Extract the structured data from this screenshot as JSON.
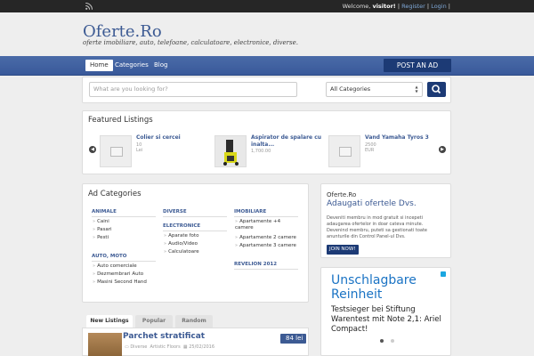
{
  "header": {
    "welcome_prefix": "Welcome,",
    "username": "visitor!",
    "register": "Register",
    "login": "Login",
    "title": "Oferte.Ro",
    "tagline": "oferte imobiliare, auto, telefoane, calculatoare, electronice, diverse."
  },
  "nav": {
    "items": [
      "Home",
      "Categories",
      "Blog"
    ],
    "active": "Home",
    "post_ad": "POST AN AD"
  },
  "search": {
    "placeholder": "What are you looking for?",
    "category": "All Categories"
  },
  "featured": {
    "title": "Featured Listings",
    "items": [
      {
        "name": "Colier si cercei",
        "price": "10 Lei"
      },
      {
        "name": "Aspirator de spalare cu inalta...",
        "price": "1,700.00"
      },
      {
        "name": "Vand Yamaha Tyros 3",
        "price": "2500 EUR"
      }
    ]
  },
  "categories": {
    "title": "Ad Categories",
    "groups": {
      "animale": {
        "name": "ANIMALE",
        "subs": [
          "Caini",
          "Pasari",
          "Pesti"
        ]
      },
      "auto_moto": {
        "name": "AUTO, MOTO",
        "subs": [
          "Auto comerciale",
          "Dezmembrari Auto",
          "Masini Second Hand"
        ]
      },
      "diverse": {
        "name": "DIVERSE"
      },
      "electronice": {
        "name": "ELECTRONICE",
        "subs": [
          "Aparate foto",
          "Audio/Video",
          "Calculatoare"
        ]
      },
      "imobiliare": {
        "name": "IMOBILIARE",
        "subs": [
          "Apartamente +4 camere",
          "Apartamente 2 camere",
          "Apartamente 3 camere"
        ]
      },
      "revelion": {
        "name": "REVELION 2012"
      }
    }
  },
  "tabs": [
    "New Listings",
    "Popular",
    "Random"
  ],
  "listing": {
    "title": "Parchet stratificat",
    "category": "Diverse",
    "author": "Artistic Floors",
    "date": "25/02/2016",
    "price": "84 lei"
  },
  "promo": {
    "site": "Oferte.Ro",
    "title": "Adaugati ofertele Dvs.",
    "text": "Deveniti membru in mod gratuit si incepeti adaugarea ofertelor in doar cateva minute. Devenind membru, puteti sa gestionati toate anunturile din Control Panel-ul Dvs.",
    "button": "JOIN NOW!"
  },
  "ad": {
    "title": "Unschlagbare Reinheit",
    "text": "Testsieger bei Stiftung Warentest mit Note 2,1: Ariel Compact!"
  }
}
